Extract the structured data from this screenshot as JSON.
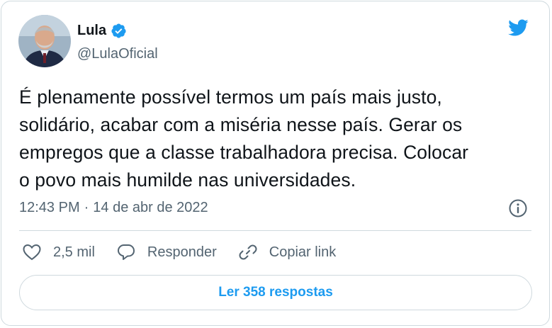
{
  "author": {
    "name": "Lula",
    "handle": "@LulaOficial"
  },
  "tweet": {
    "text": "É plenamente possível termos um país mais justo,\nsolidário, acabar com a miséria nesse país. Gerar os\nempregos que a classe trabalhadora precisa. Colocar\no povo mais humilde nas universidades.",
    "time": "12:43 PM",
    "separator": "·",
    "date": "14 de abr de 2022"
  },
  "actions": {
    "likes": "2,5 mil",
    "reply": "Responder",
    "copy_link": "Copiar link"
  },
  "replies_button": "Ler 358 respostas",
  "icons": {
    "brand": "twitter-bird-icon",
    "verified": "verified-badge-icon",
    "info": "info-icon",
    "like": "heart-icon",
    "reply": "speech-bubble-icon",
    "link": "link-icon"
  },
  "colors": {
    "brand_blue": "#1d9bf0",
    "text_primary": "#0f1419",
    "text_secondary": "#536471",
    "border": "#cfd9de"
  }
}
